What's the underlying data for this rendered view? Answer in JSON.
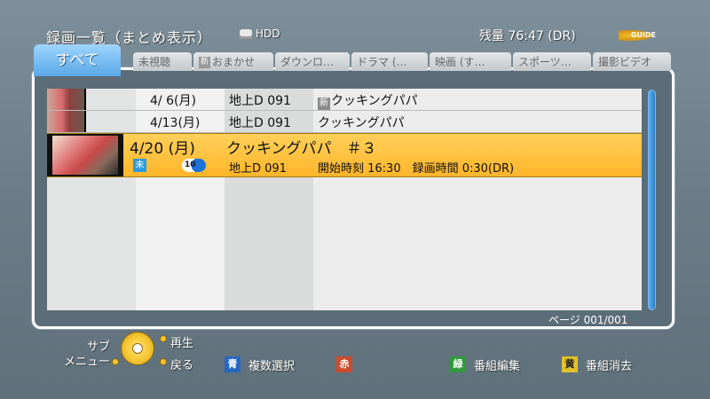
{
  "header": {
    "title": "録画一覧（まとめ表示）",
    "storage_label": "HDD",
    "remaining": "残量 76:47 (DR)",
    "logo_text": "GUIDE"
  },
  "tabs": [
    {
      "label": "すべて",
      "active": true
    },
    {
      "label": "未視聴"
    },
    {
      "label": "おまかせ",
      "icon": "新"
    },
    {
      "label": "ダウンロ…"
    },
    {
      "label": "ドラマ (…"
    },
    {
      "label": "映画 (す…"
    },
    {
      "label": "スポーツ…"
    },
    {
      "label": "撮影ビデオ"
    }
  ],
  "list": {
    "rows": [
      {
        "date": "4/ 6(月)",
        "channel": "地上D 091",
        "new_mark": "新",
        "title": "クッキングパパ"
      },
      {
        "date": "4/13(月)",
        "channel": "地上D 091",
        "title": "クッキングパパ"
      }
    ],
    "selected": {
      "date": "4/20 (月)",
      "title": "クッキングパパ　＃３",
      "badge_end": "未",
      "badge_channel": "10",
      "channel": "地上D 091",
      "info": "開始時刻 16:30　録画時間 0:30(DR)"
    }
  },
  "pagination": "ページ 001/001",
  "footer": {
    "submenu": "サブ\nメニュー",
    "play": "再生",
    "back": "戻る",
    "blue_key": "青",
    "blue_label": "複数選択",
    "red_key": "赤",
    "green_key": "緑",
    "green_label": "番組編集",
    "yellow_key": "黄",
    "yellow_label": "番組消去"
  }
}
